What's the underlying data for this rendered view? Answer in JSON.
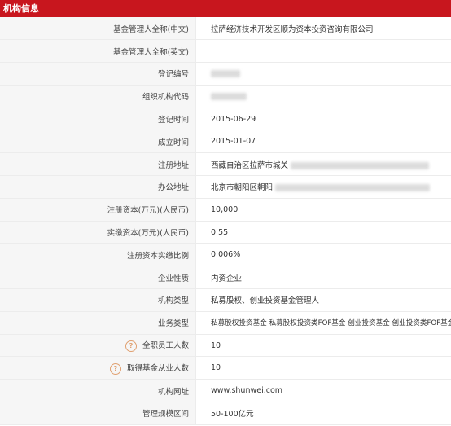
{
  "header": {
    "title": "机构信息"
  },
  "rows": [
    {
      "label": "基金管理人全称(中文)",
      "value": "拉萨经济技术开发区顺为资本投资咨询有限公司"
    },
    {
      "label": "基金管理人全称(英文)",
      "value": ""
    },
    {
      "label": "登记编号",
      "value": ""
    },
    {
      "label": "组织机构代码",
      "value": ""
    },
    {
      "label": "登记时间",
      "value": "2015-06-29"
    },
    {
      "label": "成立时间",
      "value": "2015-01-07"
    },
    {
      "label": "注册地址",
      "value": "西藏自治区拉萨市城关"
    },
    {
      "label": "办公地址",
      "value": "北京市朝阳区朝阳"
    },
    {
      "label": "注册资本(万元)(人民币)",
      "value": "10,000"
    },
    {
      "label": "实缴资本(万元)(人民币)",
      "value": "0.55"
    },
    {
      "label": "注册资本实缴比例",
      "value": "0.006%"
    },
    {
      "label": "企业性质",
      "value": "内资企业"
    },
    {
      "label": "机构类型",
      "value": "私募股权、创业投资基金管理人"
    },
    {
      "label": "业务类型",
      "value": "私募股权投资基金  私募股权投资类FOF基金  创业投资基金  创业投资类FOF基金"
    },
    {
      "label": "全职员工人数",
      "value": "10"
    },
    {
      "label": "取得基金从业人数",
      "value": "10"
    },
    {
      "label": "机构网址",
      "value": "www.shunwei.com"
    },
    {
      "label": "管理规模区间",
      "value": "50-100亿元"
    }
  ],
  "icons": {
    "help": "question-circle-icon",
    "help_glyph": "?"
  },
  "colors": {
    "header_bg": "#c8161e",
    "label_bg": "#f6f6f6",
    "help": "#e0a070"
  }
}
